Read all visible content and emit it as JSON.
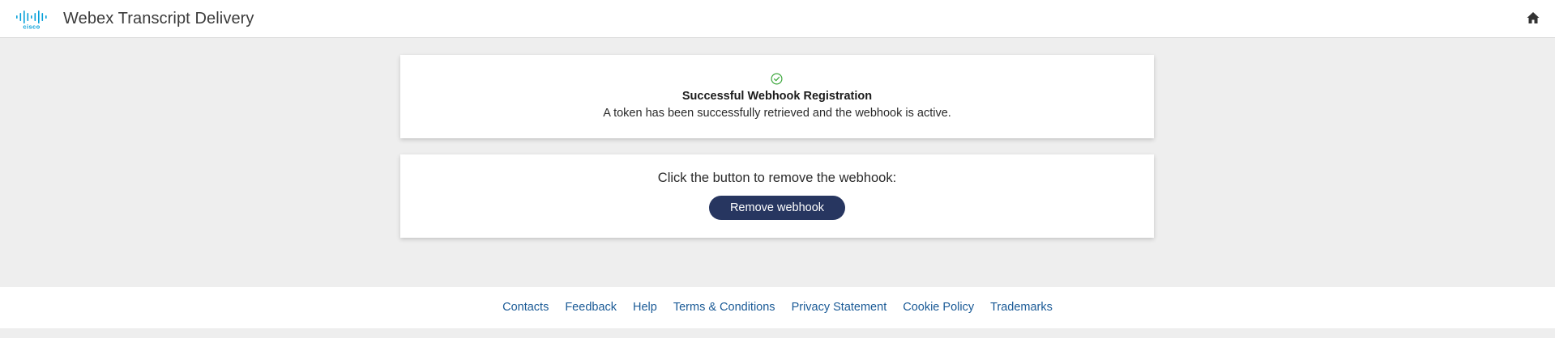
{
  "header": {
    "logo_text": "cisco",
    "title": "Webex Transcript Delivery",
    "home_icon": "home-icon"
  },
  "status_card": {
    "icon": "check-circle-icon",
    "icon_color": "#3ea83e",
    "title": "Successful Webhook Registration",
    "message": "A token has been successfully retrieved and the webhook is active."
  },
  "action_card": {
    "prompt": "Click the button to remove the webhook:",
    "button_label": "Remove webhook",
    "button_color": "#273660"
  },
  "footer": {
    "links": [
      {
        "label": "Contacts"
      },
      {
        "label": "Feedback"
      },
      {
        "label": "Help"
      },
      {
        "label": "Terms & Conditions"
      },
      {
        "label": "Privacy Statement"
      },
      {
        "label": "Cookie Policy"
      },
      {
        "label": "Trademarks"
      }
    ],
    "link_color": "#1a5a96"
  },
  "colors": {
    "brand_logo": "#049fd9",
    "page_background": "#eeeeee"
  }
}
